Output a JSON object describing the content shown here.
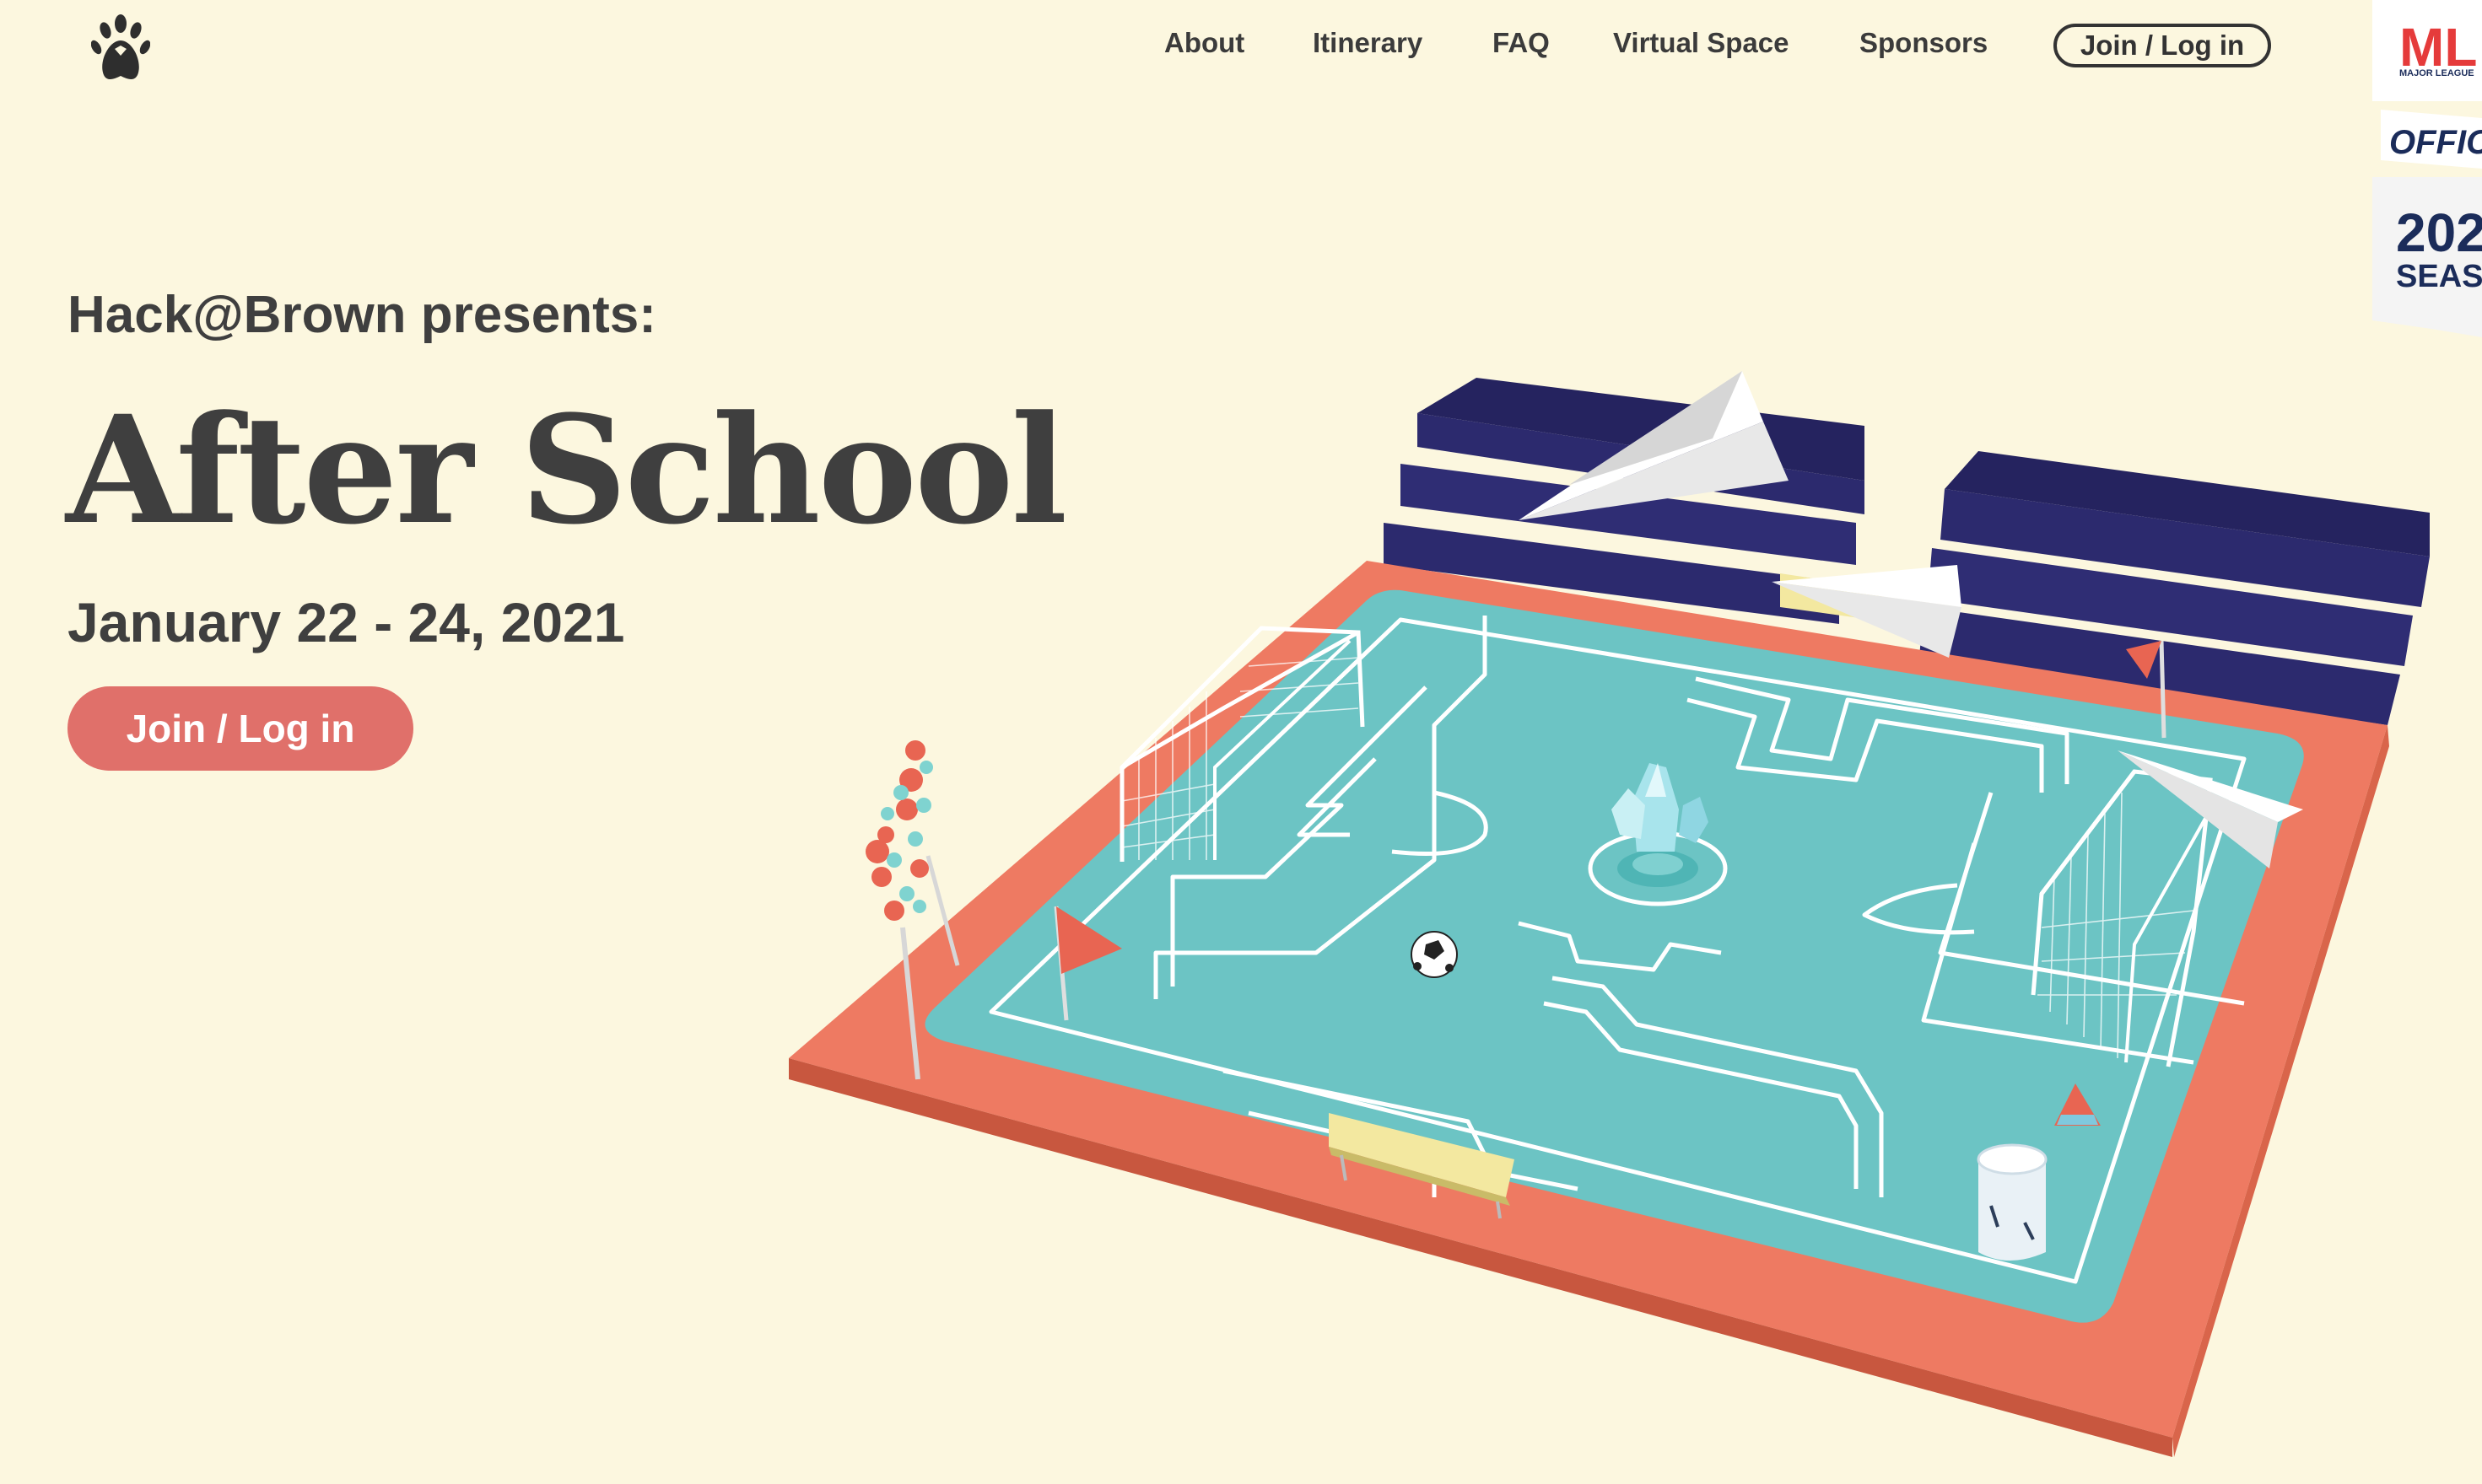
{
  "nav": {
    "items": [
      {
        "label": "About"
      },
      {
        "label": "Itinerary"
      },
      {
        "label": "FAQ"
      },
      {
        "label": "Virtual Space"
      },
      {
        "label": "Sponsors"
      }
    ],
    "join_label": "Join / Log in"
  },
  "hero": {
    "presents": "Hack@Brown presents:",
    "title": "After School",
    "dates": "January 22 - 24, 2021",
    "cta_label": "Join / Log in"
  },
  "mlh_badge": {
    "logo_text": "ML",
    "line1": "MAJOR LEAGUE",
    "line2": "OFFIC",
    "line3": "202",
    "line4": "SEAS"
  },
  "colors": {
    "background": "#fcf7df",
    "accent": "#e0706a",
    "field": "#6cc4c4",
    "track": "#ee7a62",
    "bleachers": "#2c2a6e"
  },
  "icons": {
    "logo": "paw-icon"
  }
}
